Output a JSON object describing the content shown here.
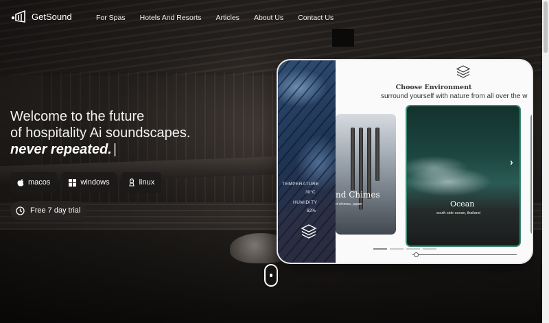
{
  "nav": {
    "brand": "GetSound",
    "links": [
      "For Spas",
      "Hotels And Resorts",
      "Articles",
      "About Us",
      "Contact Us"
    ]
  },
  "hero": {
    "line1": "Welcome to the future",
    "line2": "of hospitality Ai soundscapes.",
    "emphasis": "never repeated.",
    "cursor": "|"
  },
  "downloads": [
    {
      "label": "macos",
      "icon": "apple-icon"
    },
    {
      "label": "windows",
      "icon": "windows-icon"
    },
    {
      "label": "linux",
      "icon": "linux-icon"
    }
  ],
  "trial": {
    "label": "Free 7 day trial",
    "icon": "clock-icon"
  },
  "tablet": {
    "temperature_label": "TEMPERATURE",
    "temperature_value": "30°C",
    "humidity_label": "HUMIDITY",
    "humidity_value": "62%",
    "choose_title": "Choose Environment",
    "choose_subtitle": "surround yourself with nature from all over the w",
    "cards": [
      {
        "title": "nd Chimes",
        "subtitle": "d chimes, japan"
      },
      {
        "title": "Ocean",
        "subtitle": "south side ocean, thailand"
      }
    ]
  },
  "colors": {
    "accent": "#3a8a74",
    "button_bg": "#1c1a19"
  }
}
